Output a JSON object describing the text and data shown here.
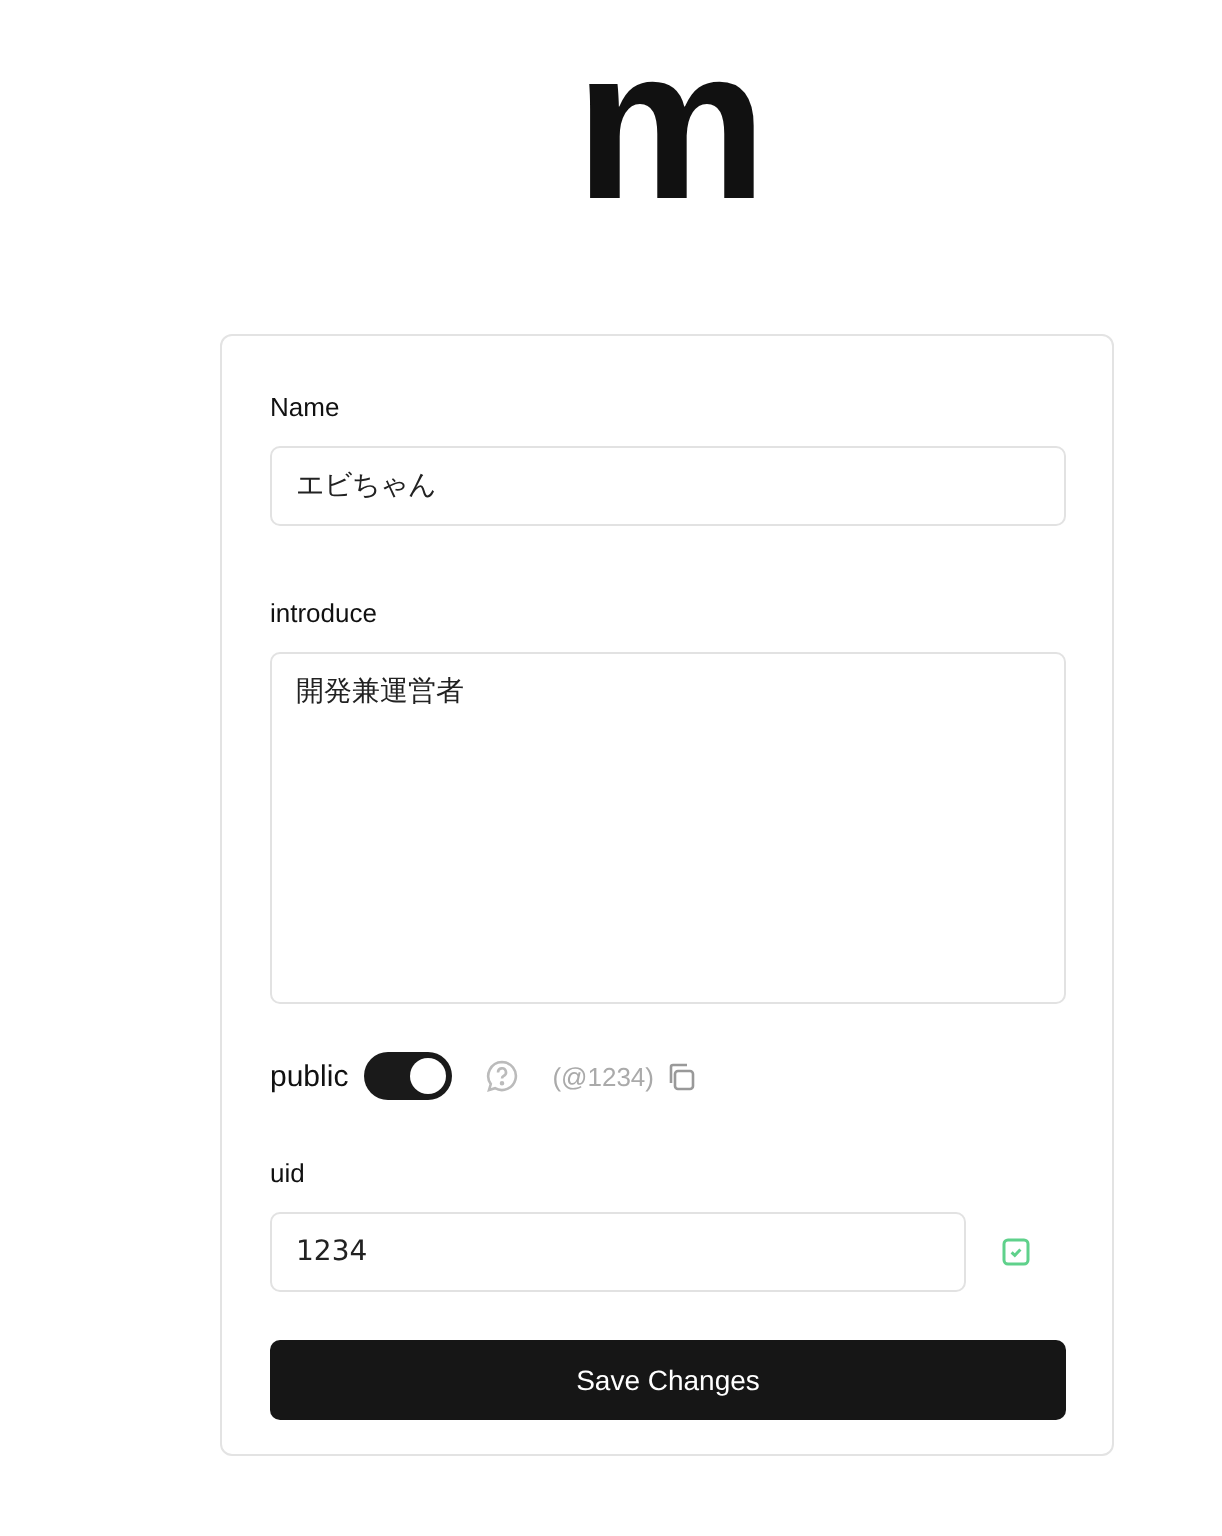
{
  "logo": "m",
  "form": {
    "name": {
      "label": "Name",
      "value": "エビちゃん"
    },
    "introduce": {
      "label": "introduce",
      "value": "開発兼運営者"
    },
    "public": {
      "label": "public",
      "on": true,
      "handle": "(@1234)"
    },
    "uid": {
      "label": "uid",
      "value": "1234"
    },
    "submit": "Save Changes"
  }
}
